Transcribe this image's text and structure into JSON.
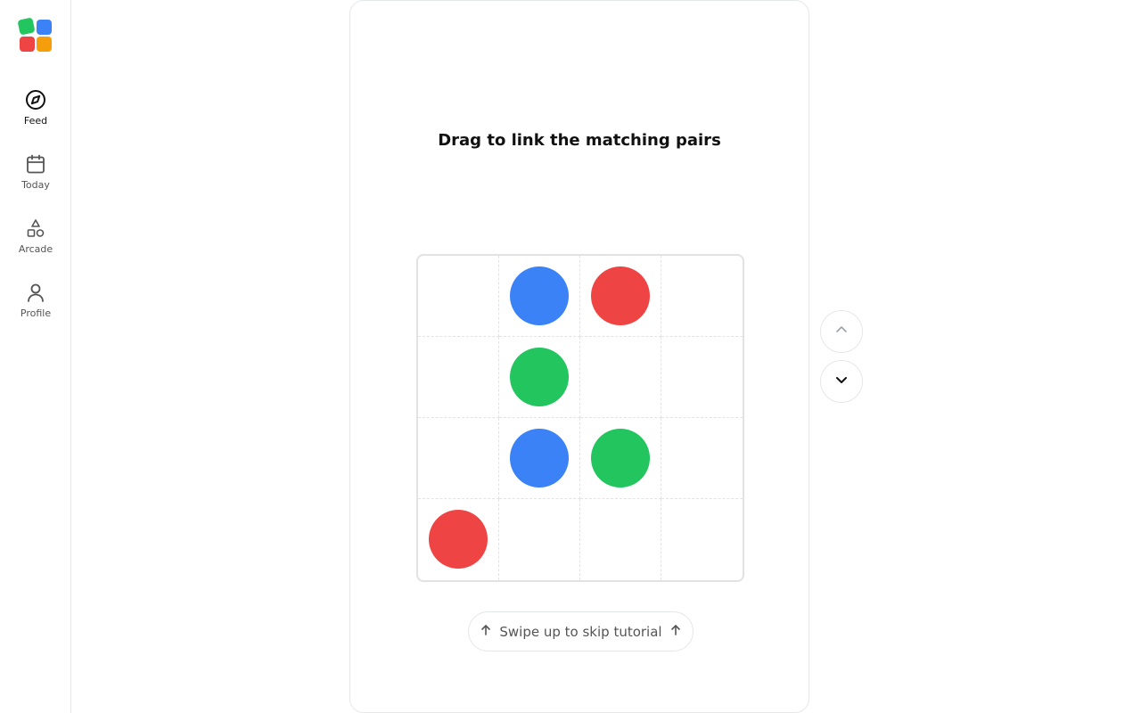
{
  "colors": {
    "blue": "#3b82f6",
    "red": "#ef4444",
    "green": "#22c55e",
    "orange": "#f59e0b"
  },
  "logo": {
    "squares": [
      "#22c55e",
      "#3b82f6",
      "#ef4444",
      "#f59e0b"
    ]
  },
  "sidebar": {
    "items": [
      {
        "label": "Feed",
        "icon": "compass-icon",
        "active": true
      },
      {
        "label": "Today",
        "icon": "calendar-icon",
        "active": false
      },
      {
        "label": "Arcade",
        "icon": "shapes-icon",
        "active": false
      },
      {
        "label": "Profile",
        "icon": "user-icon",
        "active": false
      }
    ]
  },
  "game": {
    "prompt": "Drag to link the matching pairs",
    "grid": {
      "rows": 4,
      "cols": 4,
      "dots": [
        {
          "row": 0,
          "col": 1,
          "color": "blue"
        },
        {
          "row": 0,
          "col": 2,
          "color": "red"
        },
        {
          "row": 1,
          "col": 1,
          "color": "green"
        },
        {
          "row": 2,
          "col": 1,
          "color": "blue"
        },
        {
          "row": 2,
          "col": 2,
          "color": "green"
        },
        {
          "row": 3,
          "col": 0,
          "color": "red"
        }
      ]
    },
    "skip_label": "Swipe up to skip tutorial"
  },
  "navigation": {
    "up_icon": "chevron-up-icon",
    "down_icon": "chevron-down-icon"
  }
}
